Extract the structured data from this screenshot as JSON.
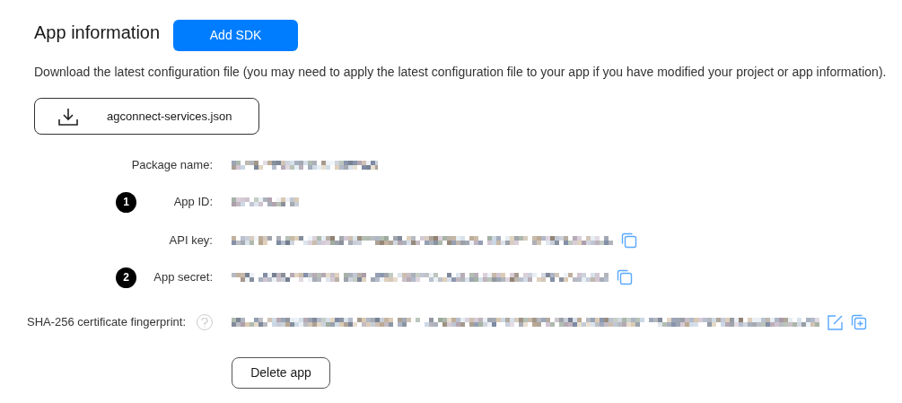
{
  "title": "App information",
  "add_sdk_button": "Add SDK",
  "description": "Download the latest configuration file (you may need to apply the latest configuration file to your app if you have modified your project or app information).",
  "download_button": "agconnect-services.json",
  "fields": [
    {
      "label": "Package name:",
      "help": false,
      "copy": false,
      "edit": false,
      "add": false
    },
    {
      "label": "App ID:",
      "badge": "1",
      "help": false,
      "copy": false,
      "edit": false,
      "add": false
    },
    {
      "label": "API key:",
      "help": false,
      "copy": true,
      "edit": false,
      "add": false
    },
    {
      "label": "App secret:",
      "badge": "2",
      "help": false,
      "copy": true,
      "edit": false,
      "add": false
    },
    {
      "label": "SHA-256 certificate fingerprint:",
      "help": true,
      "copy": false,
      "edit": true,
      "add": true
    }
  ],
  "delete_button": "Delete app"
}
